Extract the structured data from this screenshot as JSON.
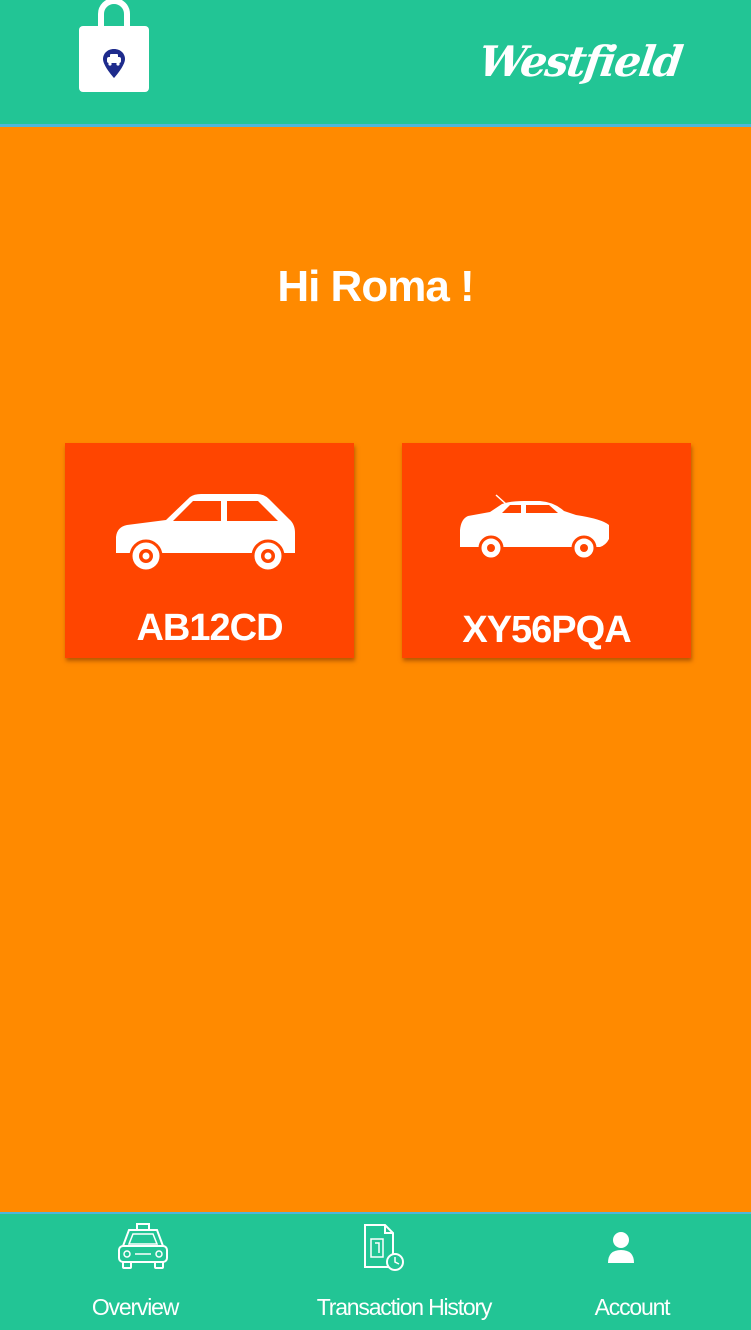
{
  "header": {
    "app_icon": "shopping-bag-location-icon",
    "brand_logo": "Westfield"
  },
  "greeting": "Hi Roma !",
  "vehicles": [
    {
      "plate": "AB12CD",
      "icon": "hatchback-car-icon"
    },
    {
      "plate": "XY56PQA",
      "icon": "sedan-car-icon"
    }
  ],
  "tabbar": {
    "items": [
      {
        "label": "Overview",
        "icon": "taxi-icon"
      },
      {
        "label": "Transaction History",
        "icon": "document-clock-icon"
      },
      {
        "label": "Account",
        "icon": "user-icon"
      }
    ]
  },
  "colors": {
    "header": "#22C595",
    "background": "#FF8A00",
    "card": "#FF4500",
    "divider": "#4FB6D9",
    "pin": "#1E2B8C"
  }
}
